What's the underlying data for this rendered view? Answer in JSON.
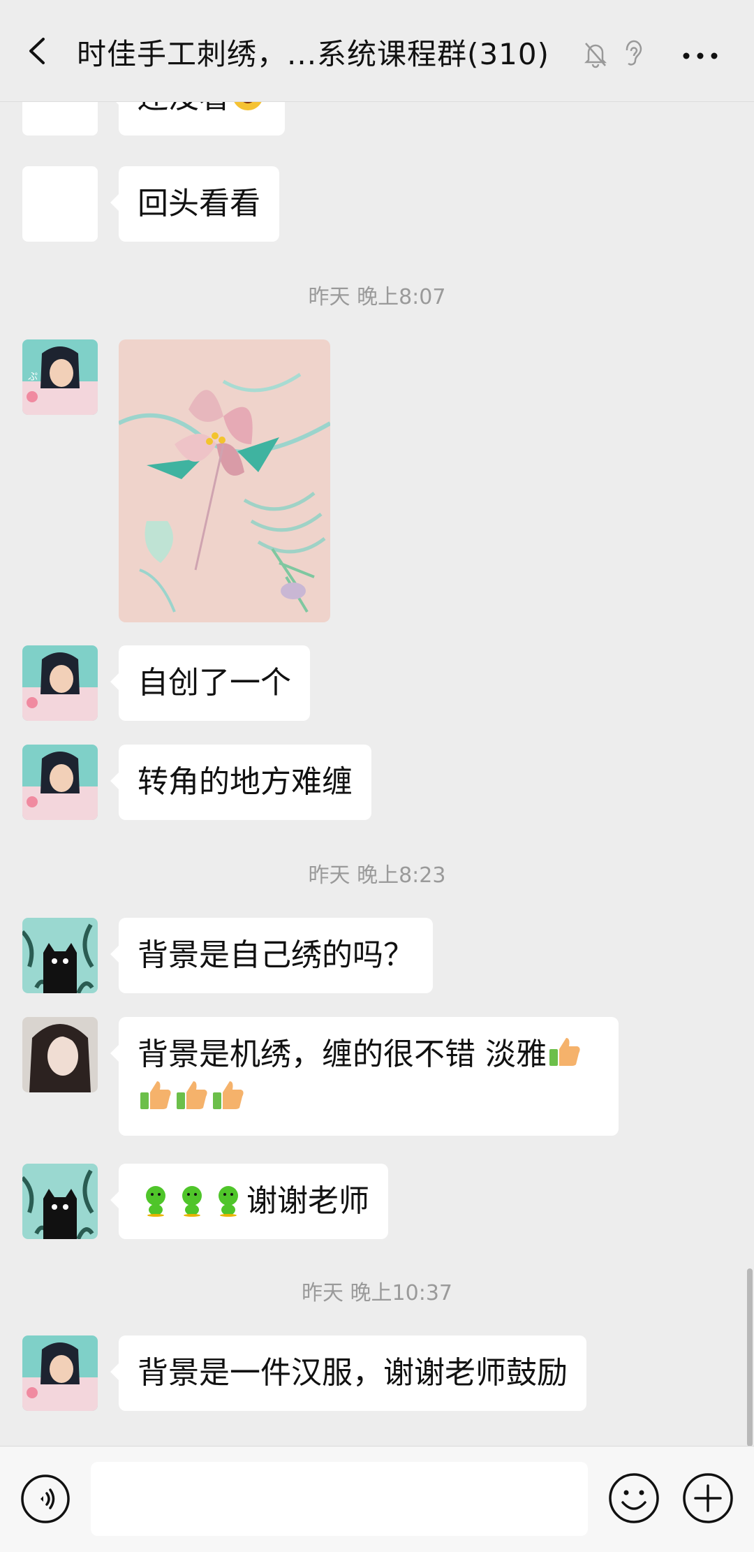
{
  "header": {
    "title": "时佳手工刺绣，...系统课程群(310)",
    "back_icon": "chevron-left-icon",
    "mute_icon": "bell-off-icon",
    "ear_icon": "ear-icon",
    "more_icon": "more-dots-icon"
  },
  "messages": {
    "m0_text": "还没看",
    "m1_text": "回头看看",
    "ts1": "昨天 晚上8:07",
    "m3_text": "自创了一个",
    "m4_text": "转角的地方难缠",
    "ts2": "昨天 晚上8:23",
    "m5_text": "背景是自己绣的吗？",
    "m6_line1": "背景是机绣，缠的很不错 淡雅",
    "m7_text": "谢谢老师",
    "ts3": "昨天 晚上10:37",
    "m8_text": "背景是一件汉服，谢谢老师鼓励"
  },
  "input": {
    "value": ""
  },
  "colors": {
    "background": "#ededed",
    "bubble": "#ffffff",
    "timestamp": "#9a9a9a"
  }
}
